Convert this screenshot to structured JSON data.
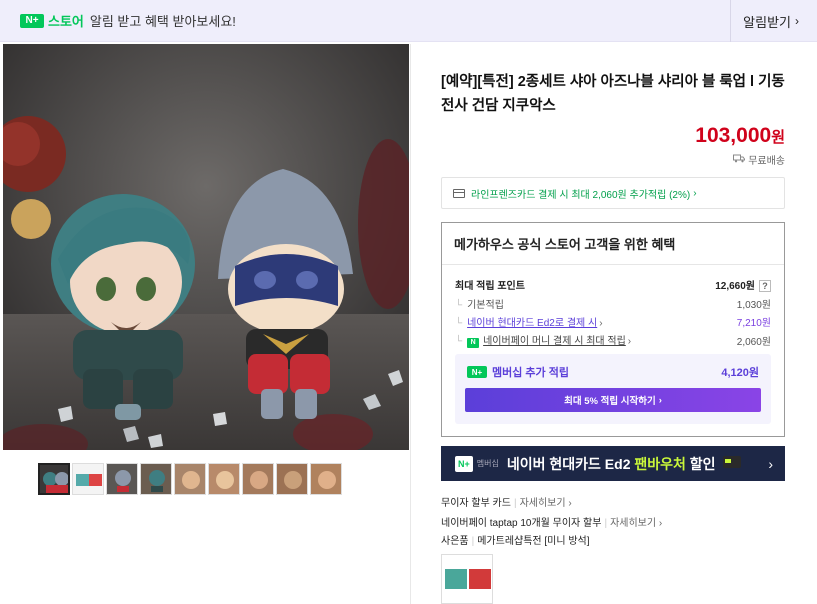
{
  "banner": {
    "npay_label": "N+",
    "store_label": "스토어",
    "message": "알림 받고 혜택 받아보세요!",
    "alarm_button": "알림받기"
  },
  "product": {
    "title": "[예약][특전] 2종세트 샤아 아즈나블 샤리아 블 룩업 l 기동전사 건담 지쿠악스",
    "price": "103,000",
    "price_unit": "원",
    "shipping": "무료배송",
    "card_benefit": "라인프렌즈카드 결제 시 최대 2,060원 추가적립 (2%)"
  },
  "benefits": {
    "heading": "메가하우스 공식 스토어 고객을 위한 혜택",
    "max_label": "최대 적립 포인트",
    "max_value": "12,660원",
    "help": "?",
    "rows": [
      {
        "label": "기본적립",
        "value": "1,030원"
      },
      {
        "label": "네이버 현대카드 Ed2로 결제 시",
        "value": "7,210원"
      },
      {
        "label": "네이버페이 머니 결제 시 최대 적립",
        "value": "2,060원"
      }
    ],
    "member_label": "멤버십 추가 적립",
    "member_value": "4,120원",
    "member_button": "최대 5% 적립 시작하기"
  },
  "promo": {
    "badge": "N+",
    "badge_sub": "멤버십",
    "text_a": "네이버 현대카드 Ed2 ",
    "text_b": "팬바우처",
    "text_c": " 할인"
  },
  "info": {
    "line1_label": "무이자 할부 카드",
    "line1_more": "자세히보기",
    "line2_label": "네이버페이 taptap 10개월 무이자 할부",
    "line2_more": "자세히보기",
    "line3_label": "사은품",
    "line3_value": "메가트레샵특전 [미니 방석]"
  },
  "colors": {
    "accent_green": "#03c75a",
    "price_red": "#d0021b",
    "membership_purple": "#5b3fd9",
    "promo_navy": "#1d2746"
  }
}
